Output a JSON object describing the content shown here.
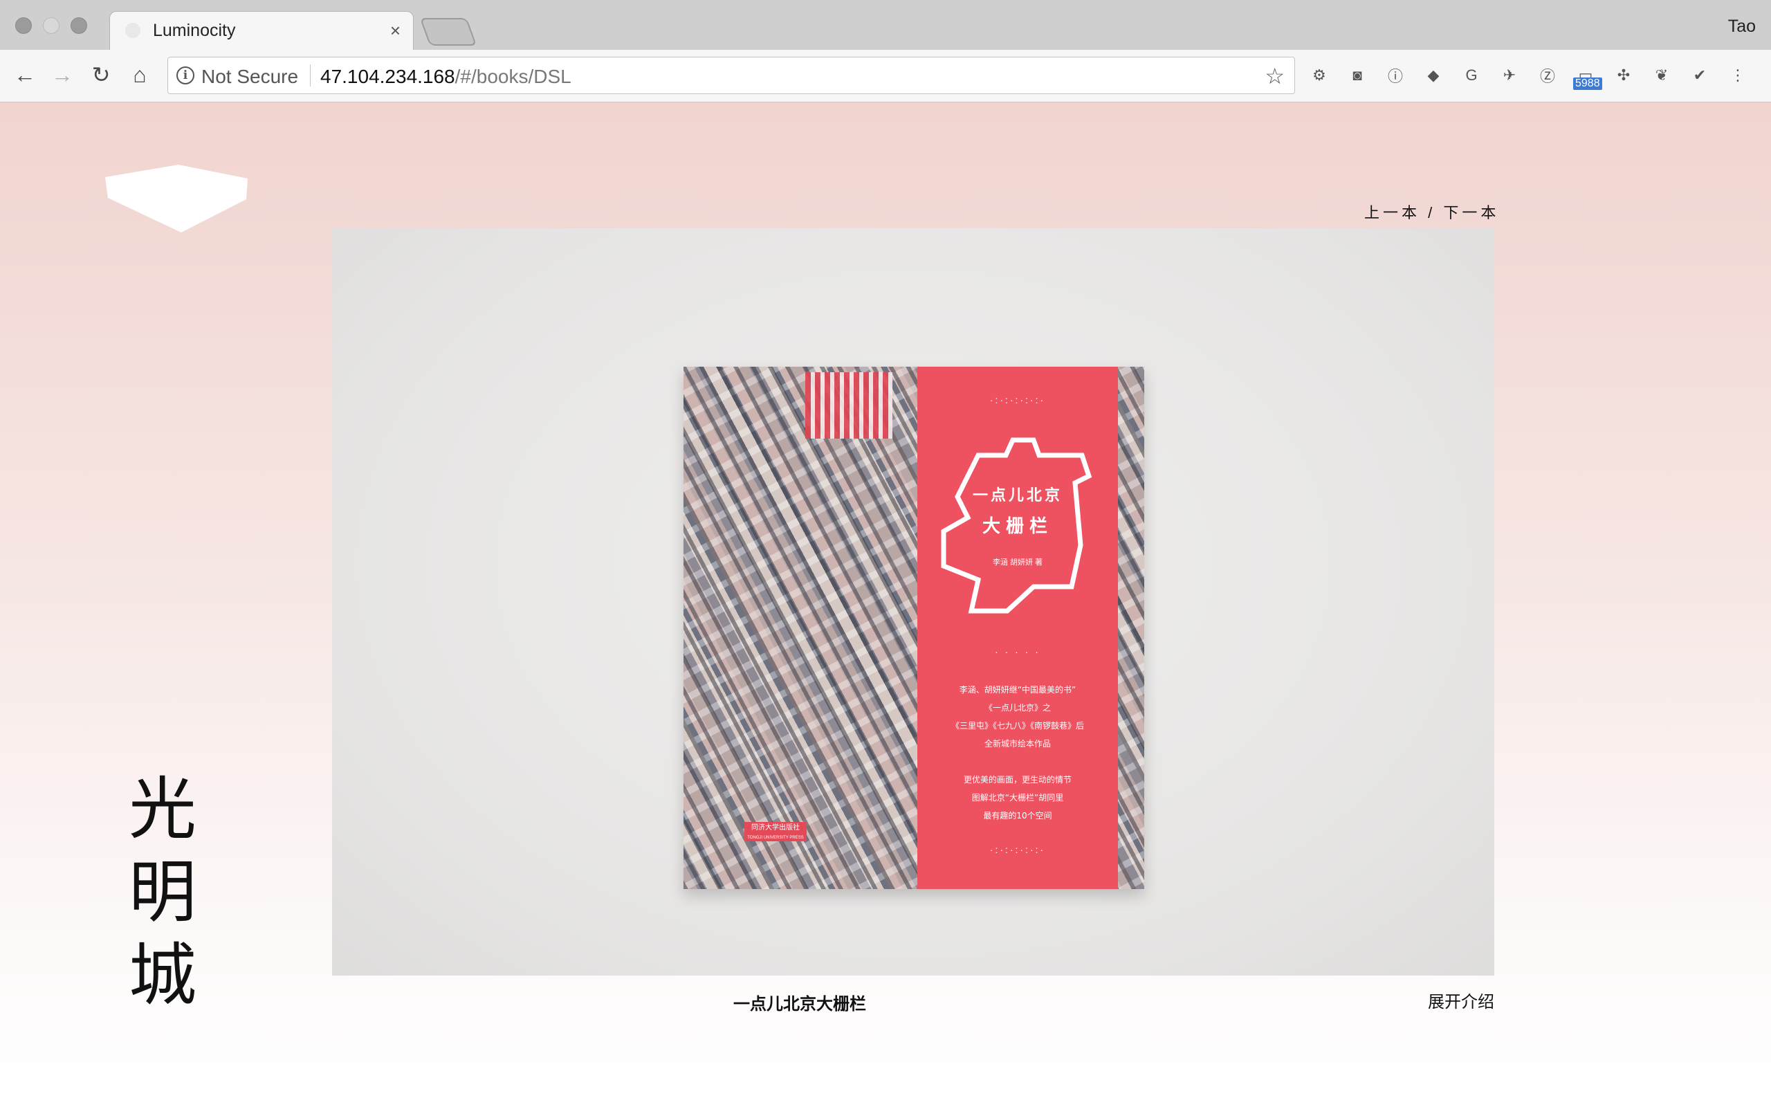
{
  "browser": {
    "tab_title": "Luminocity",
    "tab_close": "×",
    "profile_name": "Tao",
    "security_label": "Not Secure",
    "url_host": "47.104.234.168",
    "url_path": "/#/books/DSL",
    "extensions": [
      {
        "name": "film-reel-icon",
        "glyph": "⚙"
      },
      {
        "name": "pocket-icon",
        "glyph": "◙"
      },
      {
        "name": "onepassword-icon",
        "glyph": "ⓘ"
      },
      {
        "name": "graduation-cap-icon",
        "glyph": "◆"
      },
      {
        "name": "google-translate-icon",
        "glyph": "G"
      },
      {
        "name": "bird-icon",
        "glyph": "✈"
      },
      {
        "name": "zotero-icon",
        "glyph": "Ⓩ"
      },
      {
        "name": "badge-counter-icon",
        "glyph": "▭"
      },
      {
        "name": "pinwheel-icon",
        "glyph": "✣"
      },
      {
        "name": "evernote-icon",
        "glyph": "❦"
      },
      {
        "name": "shield-check-icon",
        "glyph": "✔"
      },
      {
        "name": "menu-dots-icon",
        "glyph": "⋮"
      }
    ],
    "extension_badge": "5988"
  },
  "page": {
    "pager_prev": "上一本",
    "pager_sep": "/",
    "pager_next": "下一本",
    "site_name_chars": [
      "光",
      "明",
      "城"
    ],
    "book_caption": "一点儿北京大栅栏",
    "expand_label": "展开介绍"
  },
  "book_cover": {
    "series_title": "一点儿北京",
    "main_title": "大栅栏",
    "author": "李涵 胡妍妍 著",
    "blurb": [
      "李涵、胡妍妍继“中国最美的书”",
      "《一点儿北京》之",
      "《三里屯》《七九八》《南锣鼓巷》后",
      "全新城市绘本作品",
      "更优美的画面，更生动的情节",
      "图解北京“大栅栏”胡同里",
      "最有趣的10个空间"
    ],
    "publisher": "同济大学出版社",
    "publisher_en": "TONGJI UNIVERSITY PRESS",
    "band_color": "#ee5160"
  }
}
